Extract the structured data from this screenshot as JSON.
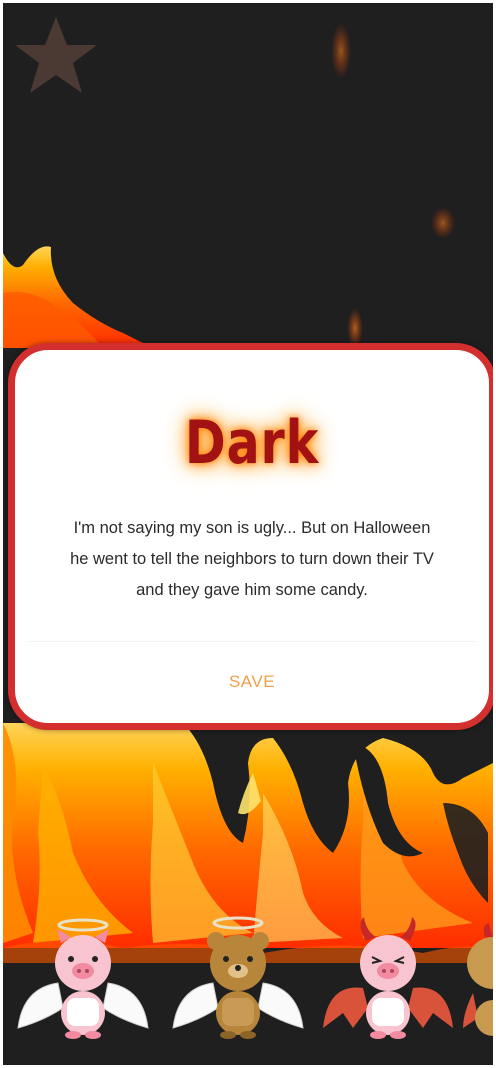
{
  "screen": {
    "background_color": "#1f1f1f",
    "fire_colors": [
      "#ff3b00",
      "#ff7a00",
      "#ffb000",
      "#ffe36b"
    ]
  },
  "star_button": {
    "icon": "star-icon",
    "color": "#4a3a33"
  },
  "modal": {
    "title": "Dark",
    "joke": "I'm not saying my son is ugly... But on Halloween he went to tell the neighbors to turn down their TV and they gave him some candy.",
    "save_label": "SAVE",
    "border_color": "#d32f2f",
    "title_color": "#a31212",
    "save_color": "#f0a04b"
  },
  "characters": [
    {
      "name": "angel-pig",
      "icon": "angel-pig-icon"
    },
    {
      "name": "angel-bear",
      "icon": "angel-bear-icon"
    },
    {
      "name": "devil-pig",
      "icon": "devil-pig-icon"
    },
    {
      "name": "devil-partial",
      "icon": "devil-character-icon"
    }
  ]
}
